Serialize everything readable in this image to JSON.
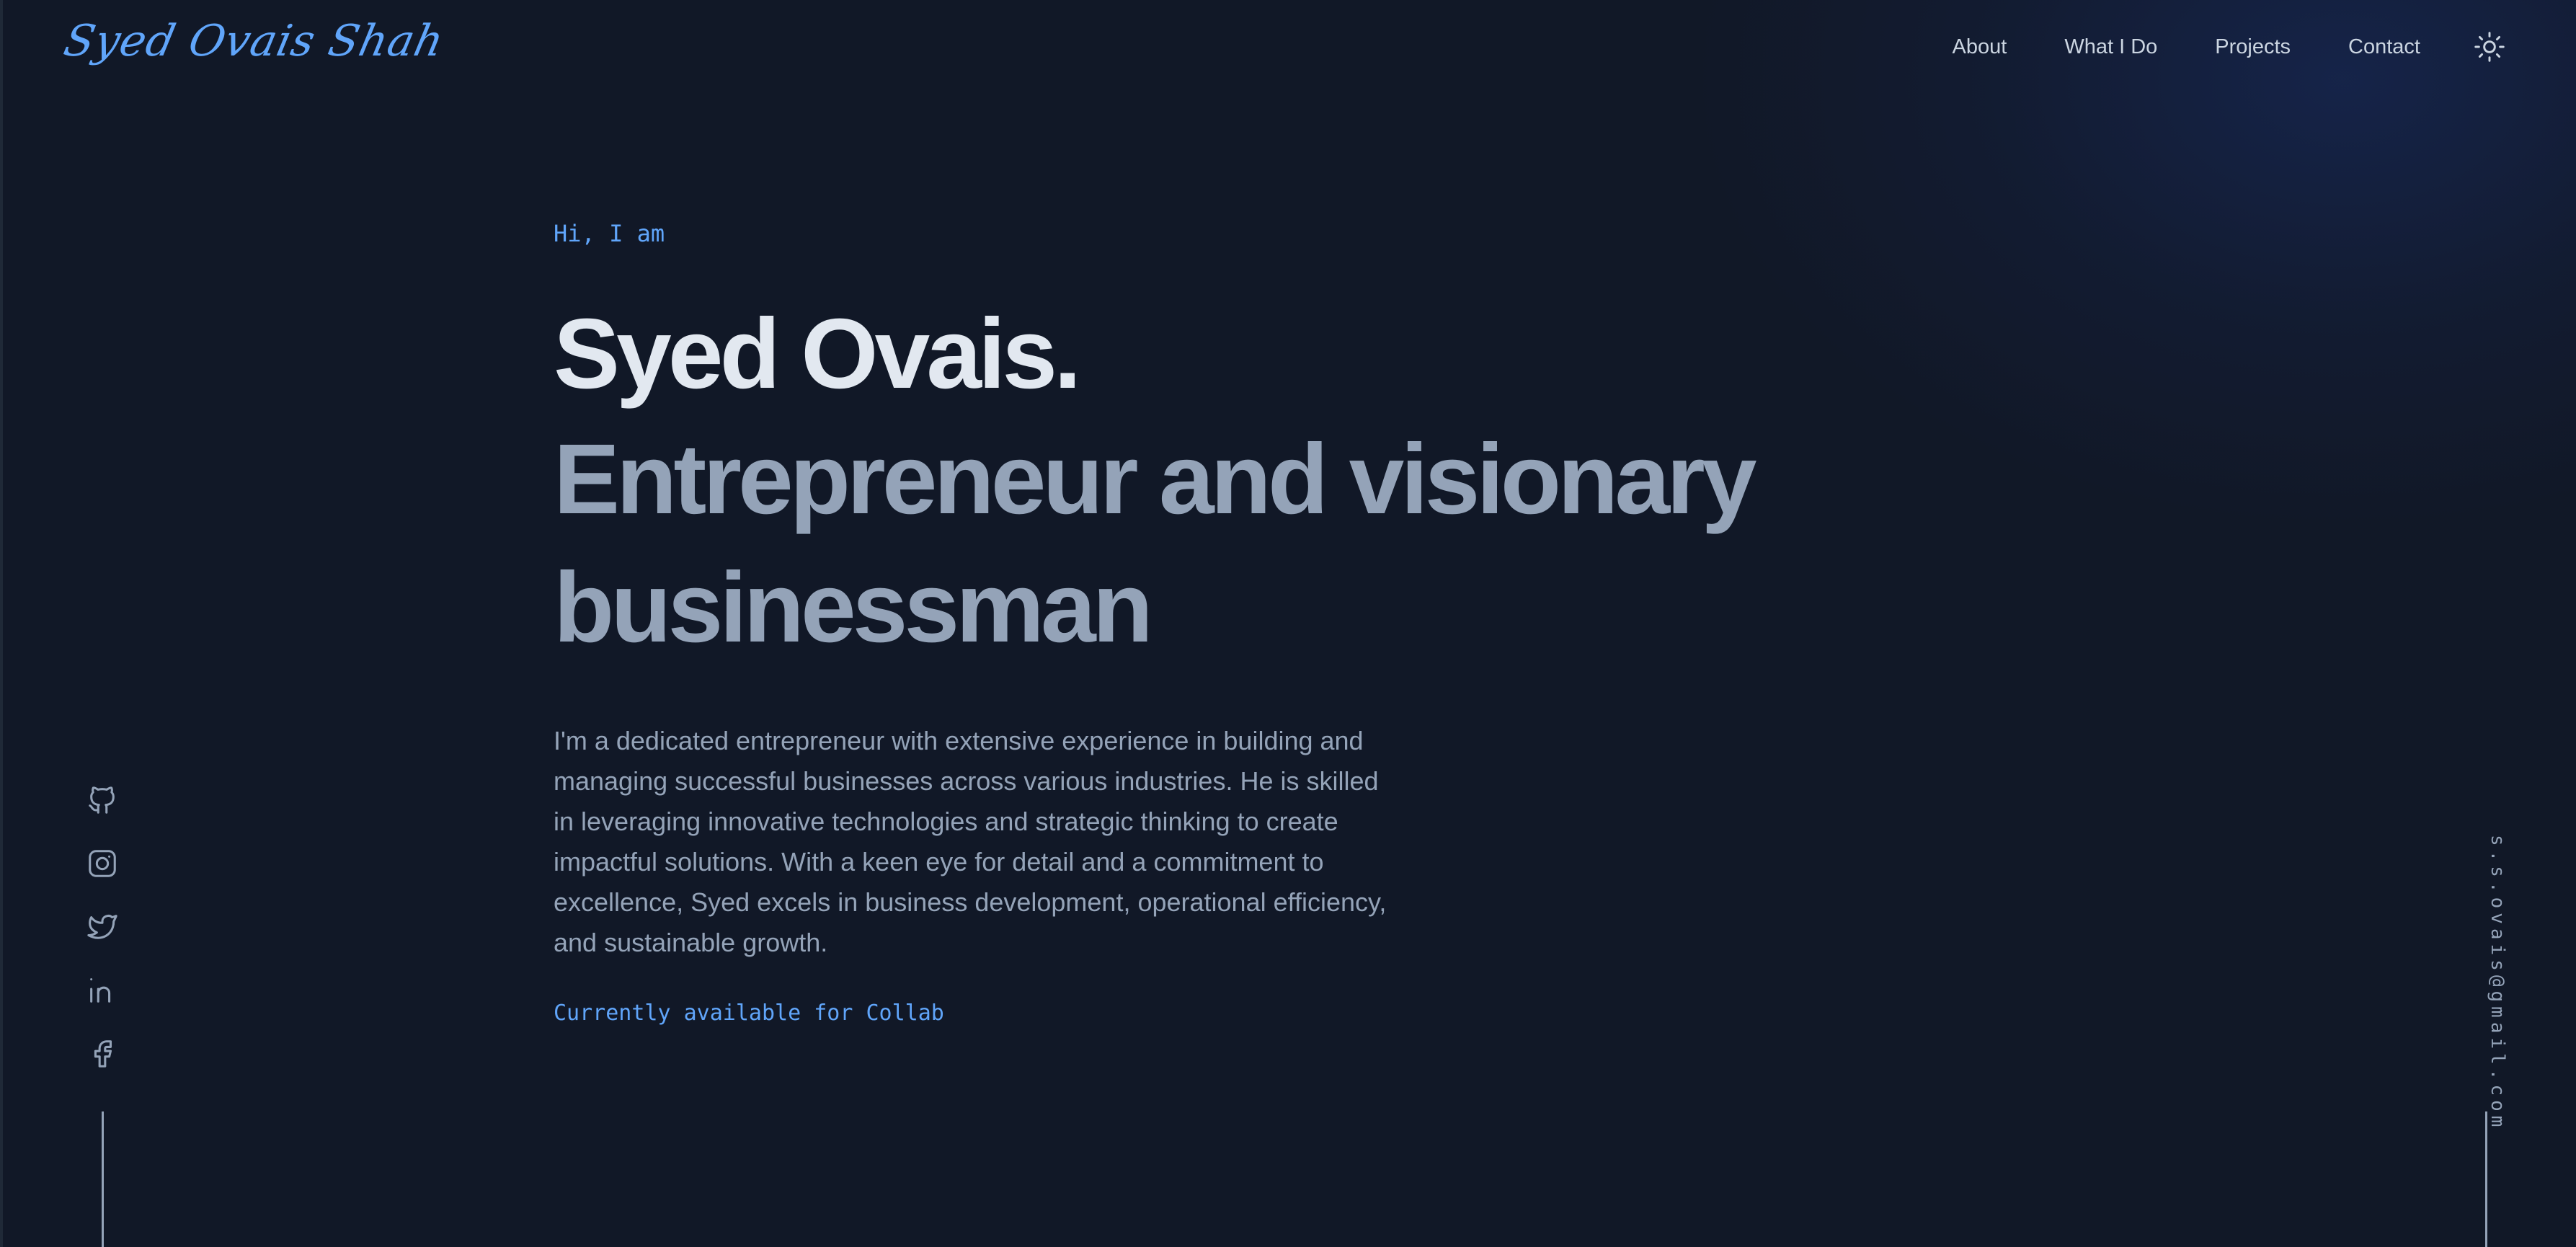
{
  "logo": {
    "text": "Syed Ovais Shah"
  },
  "nav": {
    "items": [
      {
        "label": "About"
      },
      {
        "label": "What I Do"
      },
      {
        "label": "Projects"
      },
      {
        "label": "Contact"
      }
    ],
    "theme_toggle_icon": "sun-icon"
  },
  "hero": {
    "greeting": "Hi, I am",
    "name": "Syed Ovais.",
    "title_line1": "Entrepreneur and visionary",
    "title_line2": "businessman",
    "bio": "I'm a dedicated entrepreneur with extensive experience in building and managing successful businesses across various industries. He is skilled in leveraging innovative technologies and strategic thinking to create impactful solutions. With a keen eye for detail and a commitment to excellence, Syed excels in business development, operational efficiency, and sustainable growth.",
    "collab": "Currently available for Collab"
  },
  "socials": [
    {
      "icon": "github-icon"
    },
    {
      "icon": "instagram-icon"
    },
    {
      "icon": "twitter-icon"
    },
    {
      "icon": "linkedin-icon"
    },
    {
      "icon": "facebook-icon"
    }
  ],
  "email": "s.s.ovais@gmail.com",
  "colors": {
    "background": "#111827",
    "accent": "#60a5fa",
    "heading": "#e2e8f0",
    "muted": "#94a3b8",
    "nav_text": "#cbd5e1"
  }
}
